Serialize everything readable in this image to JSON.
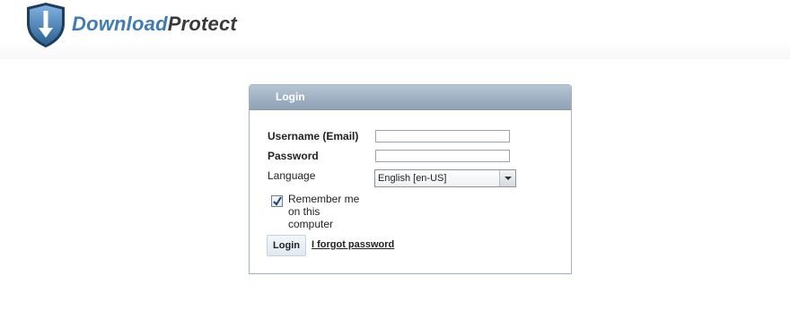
{
  "brand": {
    "name_part1": "Download",
    "name_part2": "Protect"
  },
  "login": {
    "title": "Login",
    "username_label": "Username (Email)",
    "username_value": "",
    "password_label": "Password",
    "password_value": "",
    "language_label": "Language",
    "language_selected": "English [en-US]",
    "remember_label": "Remember me on this computer",
    "remember_checked": true,
    "login_button": "Login",
    "forgot_link": "I forgot password"
  },
  "icons": {
    "logo": "shield-download-icon",
    "checkbox": "checkmark-icon",
    "dropdown": "chevron-down-icon"
  },
  "colors": {
    "brand_blue": "#3f7cb5",
    "brand_dark": "#3a3a3a",
    "panel_header": "#9fb1c3"
  }
}
